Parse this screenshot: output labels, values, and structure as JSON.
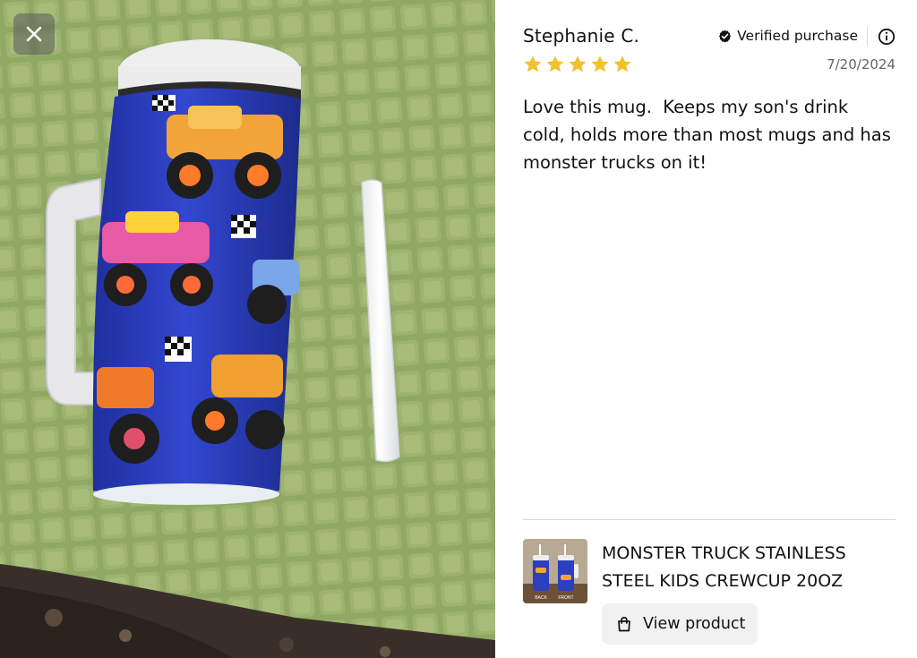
{
  "review": {
    "reviewer_name": "Stephanie C.",
    "verified_label": "Verified purchase",
    "rating": 5,
    "rating_max": 5,
    "date": "7/20/2024",
    "body": "Love this mug.  Keeps my son's drink cold, holds more than most mugs and has monster trucks on it!"
  },
  "product": {
    "title": "MONSTER TRUCK STAINLESS STEEL KIDS CREWCUP 20OZ",
    "thumb_labels": [
      "BACK",
      "FRONT"
    ],
    "view_button_label": "View product"
  },
  "icons": {
    "close": "close-icon",
    "verified": "check-circle-icon",
    "info": "info-icon",
    "star": "star-icon",
    "bag": "shopping-bag-icon"
  },
  "colors": {
    "star": "#f2c12e",
    "towel": "#8aa25e",
    "cup_blue": "#2b3fbf"
  }
}
